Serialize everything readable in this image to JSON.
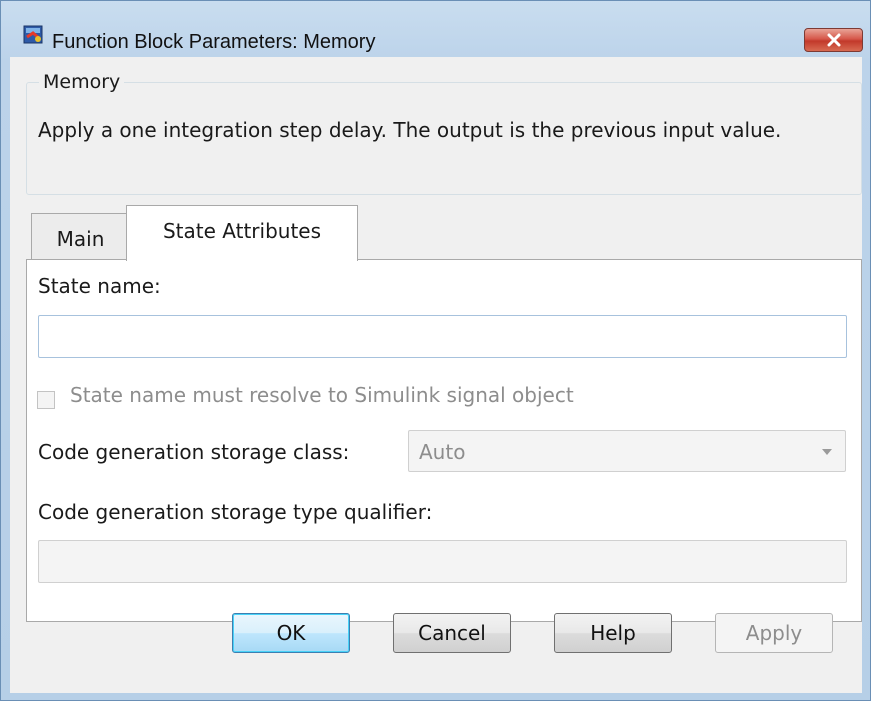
{
  "window": {
    "title": "Function Block Parameters: Memory"
  },
  "icons": {
    "app": "simulink-block-icon",
    "close": "close-icon",
    "dropdown": "chevron-down-icon"
  },
  "block": {
    "group_title": "Memory",
    "description": "Apply a one integration step delay. The output is the previous input value."
  },
  "tabs": [
    {
      "label": "Main",
      "selected": false
    },
    {
      "label": "State Attributes",
      "selected": true
    }
  ],
  "state_attributes": {
    "state_name_label": "State name:",
    "state_name_value": "",
    "resolve_checkbox_label": "State name must resolve to Simulink signal object",
    "resolve_checkbox_checked": false,
    "storage_class_label": "Code generation storage class:",
    "storage_class_value": "Auto",
    "type_qualifier_label": "Code generation storage type qualifier:",
    "type_qualifier_value": ""
  },
  "buttons": {
    "ok": "OK",
    "cancel": "Cancel",
    "help": "Help",
    "apply": "Apply"
  },
  "colors": {
    "close_button": "#c2392a",
    "ok_focus": "#48d2f8"
  }
}
